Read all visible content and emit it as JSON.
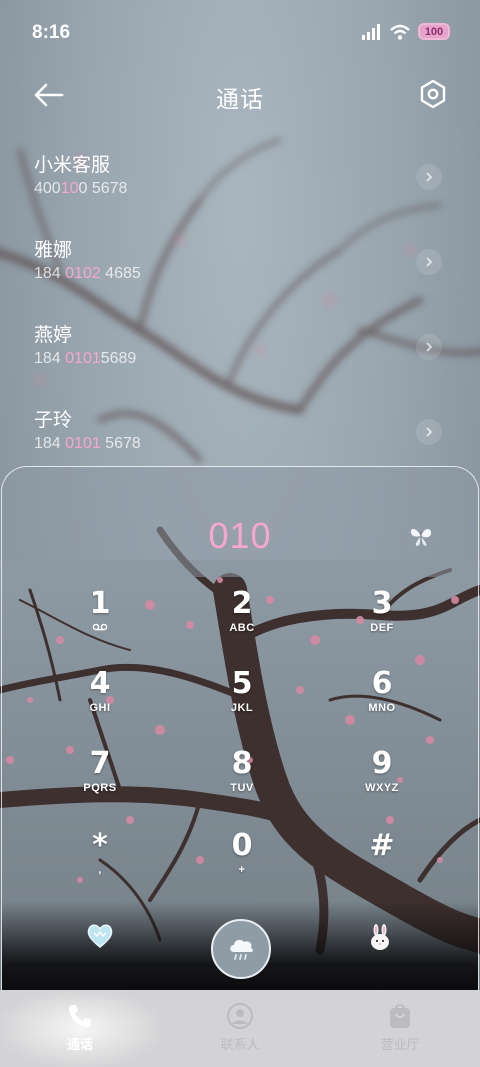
{
  "status_bar": {
    "time": "8:16",
    "battery": "100"
  },
  "header": {
    "title": "通话"
  },
  "contacts": [
    {
      "name": "小米客服",
      "number_parts": [
        "400",
        " ",
        "10",
        "0 5678"
      ],
      "highlight": [
        false,
        false,
        true,
        false
      ]
    },
    {
      "name": "雅娜",
      "number_parts": [
        "184 ",
        "0102",
        " 4685"
      ],
      "highlight": [
        false,
        true,
        false
      ]
    },
    {
      "name": "燕婷",
      "number_parts": [
        "184 ",
        "0101",
        "5689"
      ],
      "highlight": [
        false,
        true,
        false
      ]
    },
    {
      "name": "子玲",
      "number_parts": [
        "184 ",
        "0101",
        " 5678"
      ],
      "highlight": [
        false,
        true,
        false
      ]
    }
  ],
  "dialer": {
    "display": "010",
    "keys": [
      {
        "digit": "1",
        "letters": ""
      },
      {
        "digit": "2",
        "letters": "ABC"
      },
      {
        "digit": "3",
        "letters": "DEF"
      },
      {
        "digit": "4",
        "letters": "GHI"
      },
      {
        "digit": "5",
        "letters": "JKL"
      },
      {
        "digit": "6",
        "letters": "MNO"
      },
      {
        "digit": "7",
        "letters": "PQRS"
      },
      {
        "digit": "8",
        "letters": "TUV"
      },
      {
        "digit": "9",
        "letters": "WXYZ"
      },
      {
        "digit": "*",
        "letters": ","
      },
      {
        "digit": "0",
        "letters": "+"
      },
      {
        "digit": "#",
        "letters": ""
      }
    ]
  },
  "nav": [
    {
      "label": "通话",
      "icon": "phone-icon",
      "active": true
    },
    {
      "label": "联系人",
      "icon": "person-icon",
      "active": false
    },
    {
      "label": "营业厅",
      "icon": "bag-icon",
      "active": false
    }
  ],
  "colors": {
    "accent_pink": "#f6a7cb",
    "nav_bg": "#d3d3d5"
  }
}
